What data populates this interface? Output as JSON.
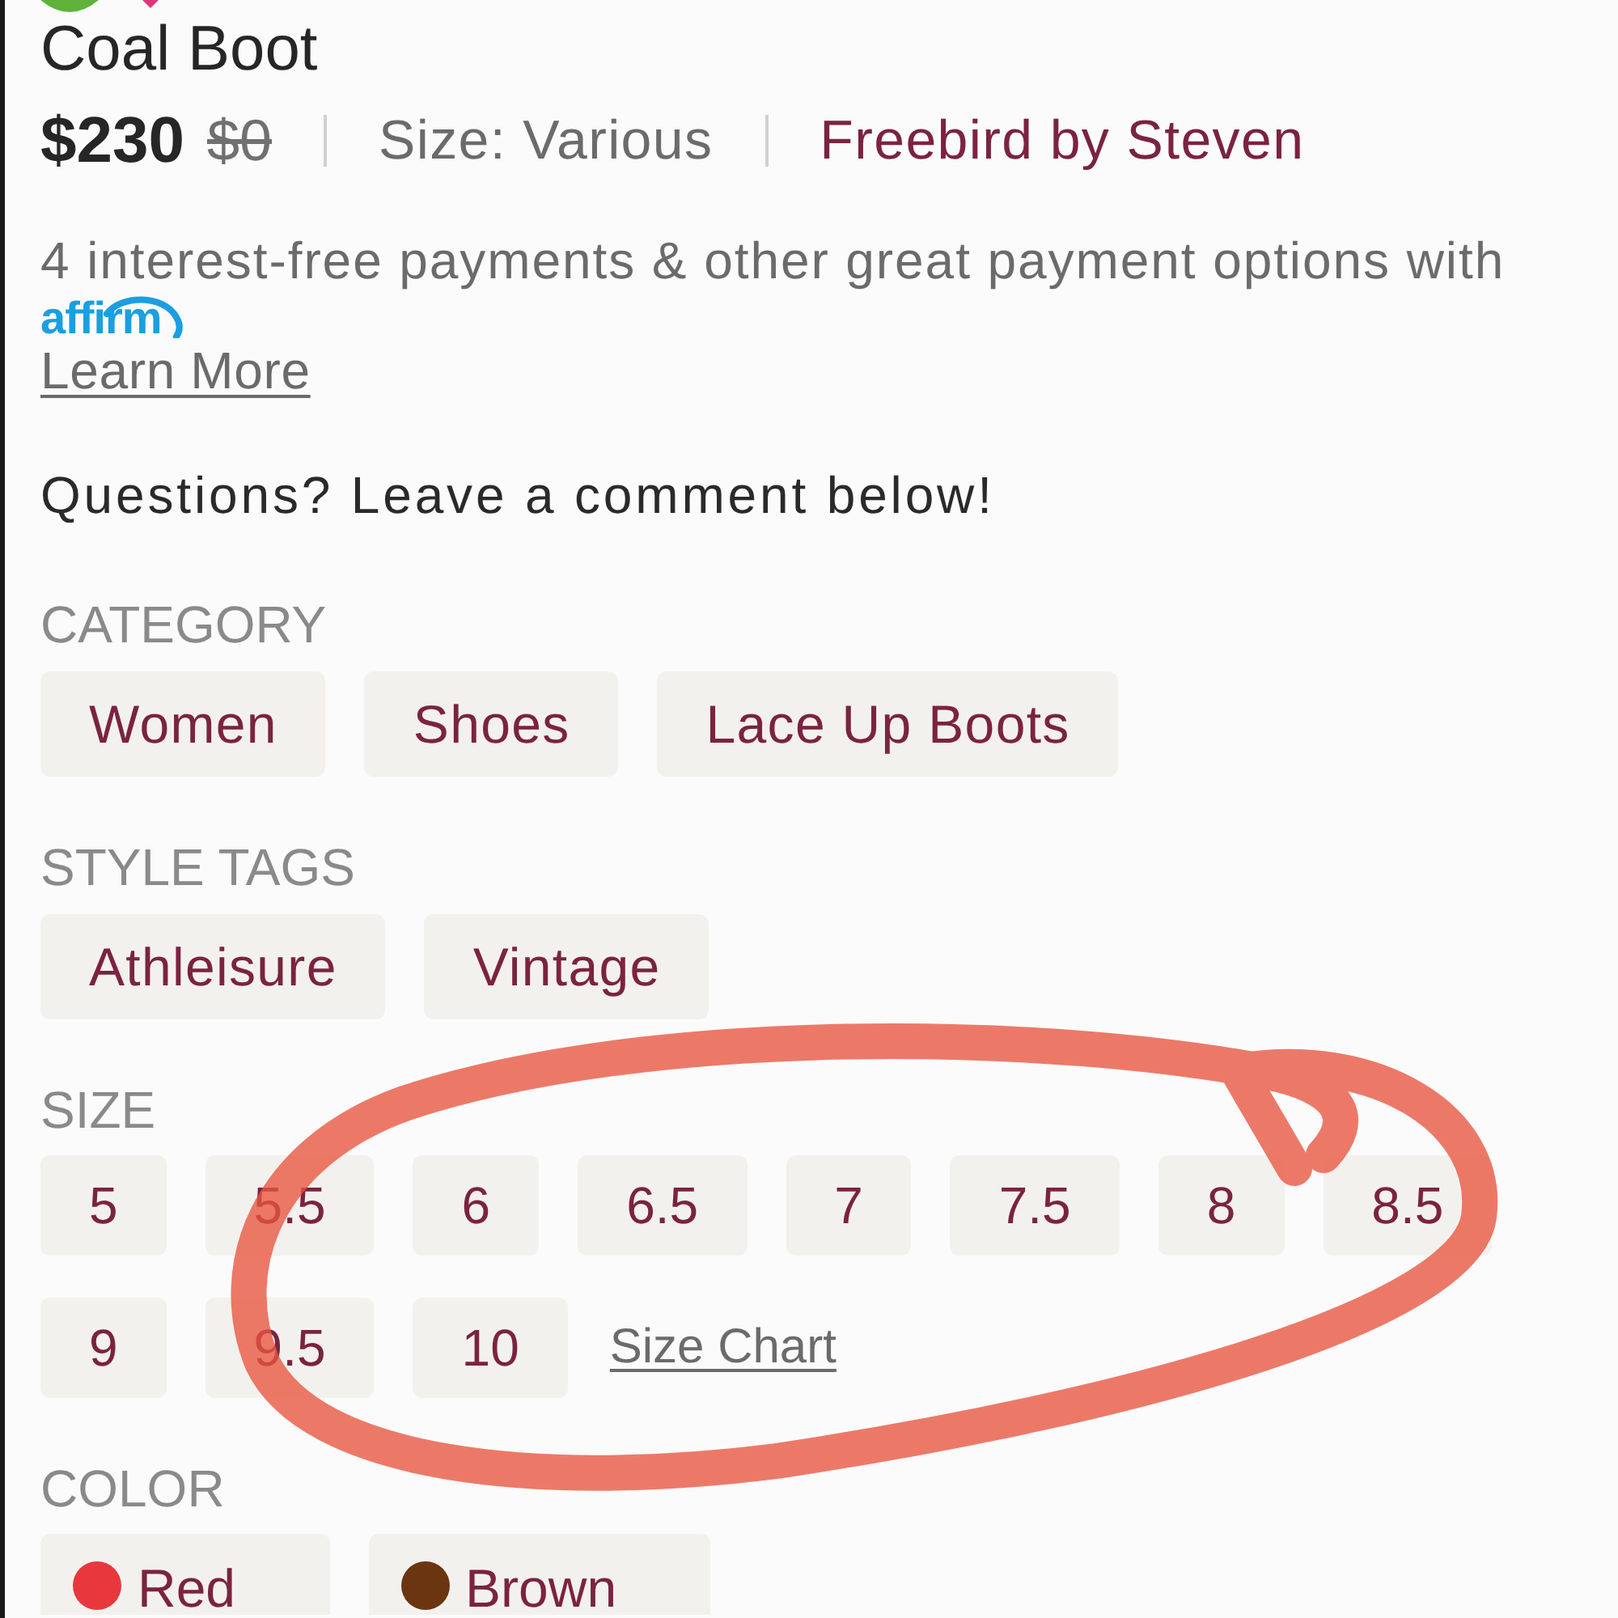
{
  "listing": {
    "title": "Coal Boot",
    "price": "$230",
    "original_price": "$0",
    "size": "Size: Various",
    "brand": "Freebird by Steven"
  },
  "payment": {
    "text": "4 interest-free payments & other great payment options with",
    "provider": "affirm",
    "link": "Learn More"
  },
  "note": "Questions? Leave a comment below!",
  "sections": [
    {
      "kind": "tags",
      "heading": "CATEGORY",
      "items": [
        "Women",
        "Shoes",
        "Lace Up Boots"
      ]
    },
    {
      "kind": "tags",
      "heading": "STYLE TAGS",
      "items": [
        "Athleisure",
        "Vintage"
      ]
    },
    {
      "kind": "sizes",
      "heading": "SIZE",
      "items": [
        "5",
        "5.5",
        "6",
        "6.5",
        "7",
        "7.5",
        "8",
        "8.5",
        "9",
        "9.5",
        "10"
      ],
      "link": "Size Chart"
    },
    {
      "kind": "colors",
      "heading": "COLOR",
      "items": [
        {
          "label": "Red",
          "color": "#e8383d"
        },
        {
          "label": "Brown",
          "color": "#6b3510"
        }
      ]
    }
  ]
}
